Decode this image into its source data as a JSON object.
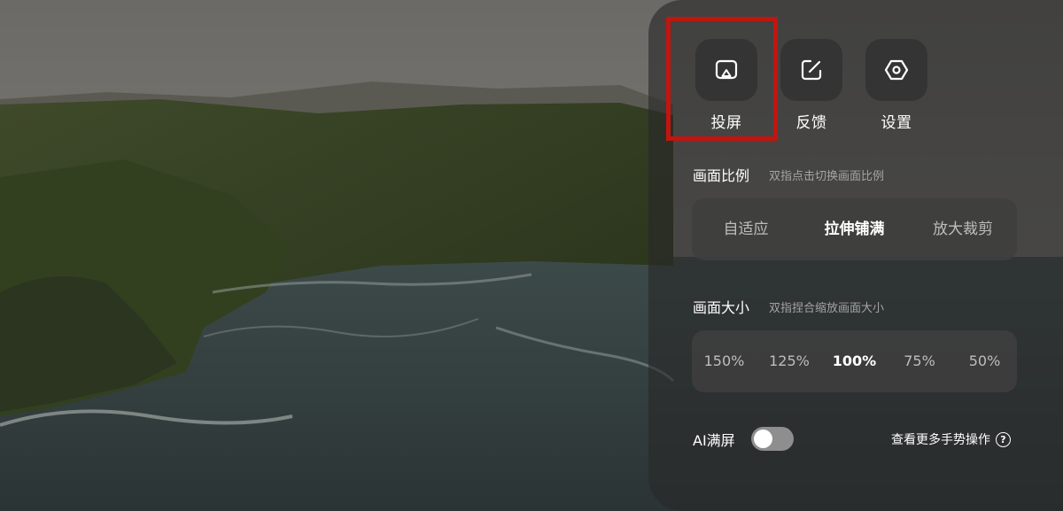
{
  "actions": [
    {
      "label": "投屏",
      "icon": "cast-icon"
    },
    {
      "label": "反馈",
      "icon": "feedback-edit-icon"
    },
    {
      "label": "设置",
      "icon": "settings-hexagon-icon"
    }
  ],
  "aspect_ratio": {
    "title": "画面比例",
    "hint": "双指点击切换画面比例",
    "options": [
      "自适应",
      "拉伸铺满",
      "放大裁剪"
    ],
    "selected": "拉伸铺满"
  },
  "screen_size": {
    "title": "画面大小",
    "hint": "双指捏合缩放画面大小",
    "options": [
      "150%",
      "125%",
      "100%",
      "75%",
      "50%"
    ],
    "selected": "100%"
  },
  "ai_fullscreen": {
    "label": "AI满屏",
    "enabled": false
  },
  "more_gestures": {
    "label": "查看更多手势操作"
  },
  "colors": {
    "highlight": "#c11510",
    "panel": "#282828"
  }
}
